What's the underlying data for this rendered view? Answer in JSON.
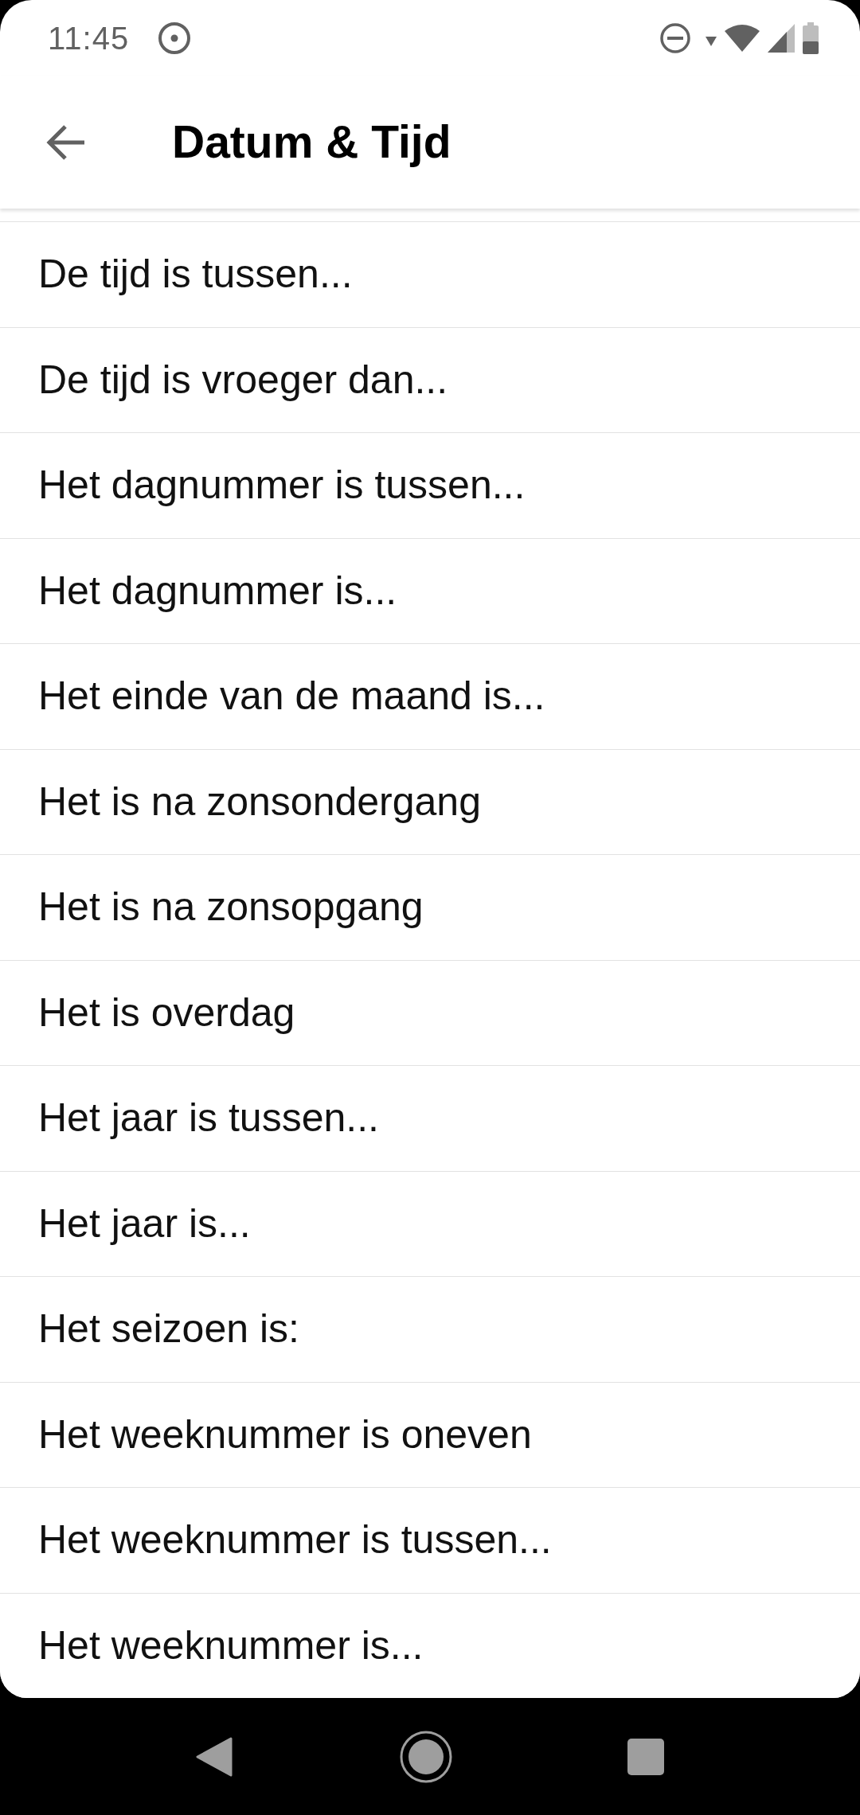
{
  "status_bar": {
    "time": "11:45"
  },
  "app_bar": {
    "title": "Datum & Tijd"
  },
  "conditions": [
    {
      "label": "De tijd is tussen..."
    },
    {
      "label": "De tijd is vroeger dan..."
    },
    {
      "label": "Het dagnummer is tussen..."
    },
    {
      "label": "Het dagnummer is..."
    },
    {
      "label": "Het einde van de maand is..."
    },
    {
      "label": "Het is na zonsondergang"
    },
    {
      "label": "Het is na zonsopgang"
    },
    {
      "label": "Het is overdag"
    },
    {
      "label": "Het jaar is tussen..."
    },
    {
      "label": "Het jaar is..."
    },
    {
      "label": "Het seizoen is:"
    },
    {
      "label": "Het weeknummer is oneven"
    },
    {
      "label": "Het weeknummer is tussen..."
    },
    {
      "label": "Het weeknummer is..."
    }
  ]
}
